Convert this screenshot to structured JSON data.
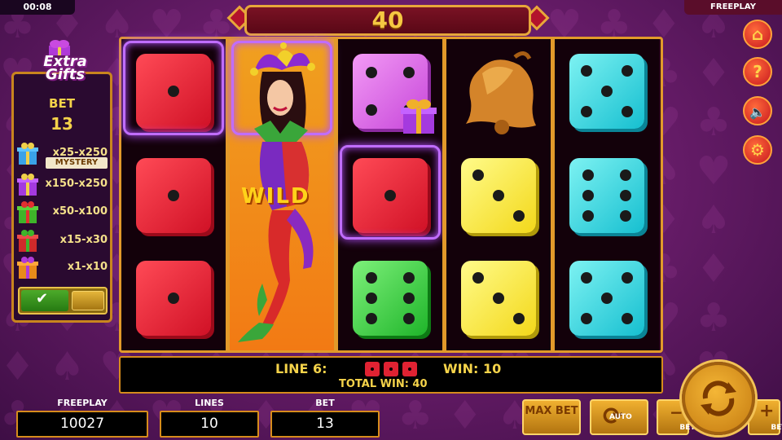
{
  "top": {
    "clock": "00:08",
    "mode": "FREEPLAY",
    "win_amount": "40"
  },
  "gift_panel": {
    "title": "Extra Gifts",
    "bet_label": "BET",
    "bet_value": "13",
    "rows": [
      {
        "range": "x25-x250",
        "color": "#3aa2e8"
      },
      {
        "range": "x150-x250",
        "color": "#a43adf"
      },
      {
        "range": "x50-x100",
        "color": "#3fb42a"
      },
      {
        "range": "x15-x30",
        "color": "#d02a2a"
      },
      {
        "range": "x1-x10",
        "color": "#e88a1a"
      }
    ],
    "mystery_label": "MYSTERY",
    "toggle_on": true
  },
  "reels": {
    "wild_label": "WILD",
    "symbols": [
      [
        "red-die-1",
        "red-die-1",
        "red-die-1"
      ],
      [
        "jester-wild"
      ],
      [
        "magenta-die-4-gift",
        "red-die-1",
        "green-die-6"
      ],
      [
        "bell",
        "yellow-die-3",
        "yellow-die-3"
      ],
      [
        "cyan-die-5",
        "cyan-die-6",
        "cyan-die-5"
      ]
    ]
  },
  "info": {
    "line_label": "LINE 6:",
    "win_label": "WIN: 10",
    "total_win_label": "TOTAL WIN: 40"
  },
  "stats": {
    "freeplay_label": "FREEPLAY",
    "freeplay_value": "10027",
    "lines_label": "LINES",
    "lines_value": "10",
    "bet_label": "BET",
    "bet_value": "13"
  },
  "buttons": {
    "max_bet": "MAX BET",
    "auto": "AUTO",
    "bet_minus": "BET",
    "bet_plus": "BET"
  },
  "colors": {
    "accent_gold": "#e29a2a",
    "text_yellow": "#f5d34a",
    "highlight_purple": "#c06dff"
  }
}
